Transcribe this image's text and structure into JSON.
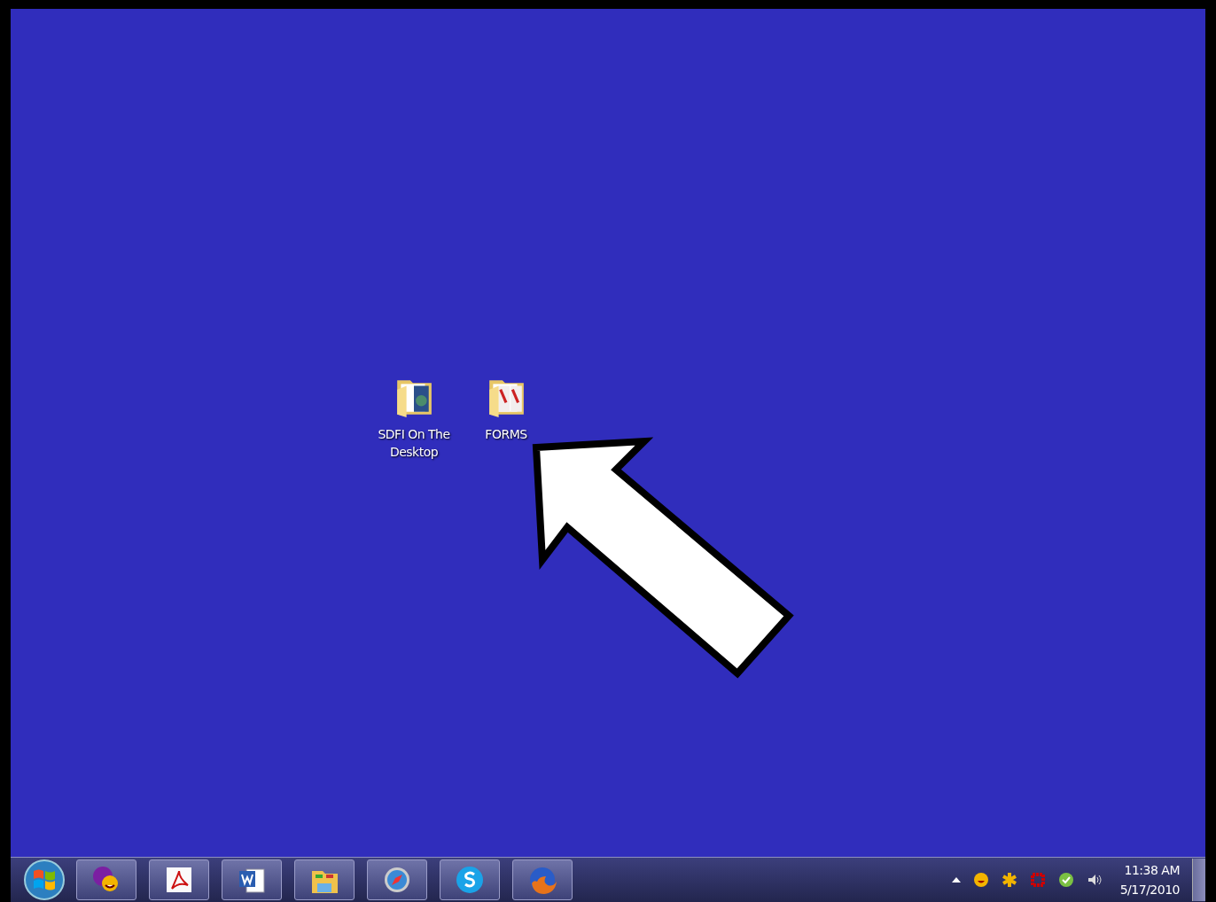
{
  "desktop_icons": [
    {
      "label": "SDFI On The Desktop",
      "kind": "globe-folder"
    },
    {
      "label": "FORMS",
      "kind": "docs-folder"
    }
  ],
  "annotation": {
    "kind": "arrow"
  },
  "taskbar": {
    "pinned": [
      {
        "kind": "messenger"
      },
      {
        "kind": "pdf"
      },
      {
        "kind": "word"
      },
      {
        "kind": "files"
      },
      {
        "kind": "compass"
      },
      {
        "kind": "chat"
      },
      {
        "kind": "fox"
      }
    ],
    "tray": [
      {
        "kind": "smiley"
      },
      {
        "kind": "asterisk"
      },
      {
        "kind": "grid"
      },
      {
        "kind": "bubble"
      },
      {
        "kind": "speaker"
      }
    ],
    "time": "11:38 AM",
    "date": "5/17/2010"
  }
}
